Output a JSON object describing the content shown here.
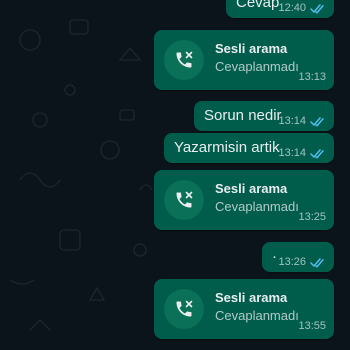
{
  "messages": [
    {
      "type": "text",
      "text": "Cevap",
      "time": "12:40",
      "status": "read"
    },
    {
      "type": "call",
      "title": "Sesli arama",
      "subtitle": "Cevaplanmadı",
      "time": "13:13",
      "icon": "missed-call-icon"
    },
    {
      "type": "text",
      "text": "Sorun nedir",
      "time": "13:14",
      "status": "read"
    },
    {
      "type": "text",
      "text": "Yazarmisin artik",
      "time": "13:14",
      "status": "read"
    },
    {
      "type": "call",
      "title": "Sesli arama",
      "subtitle": "Cevaplanmadı",
      "time": "13:25",
      "icon": "missed-call-icon"
    },
    {
      "type": "text",
      "text": "·",
      "time": "13:26",
      "status": "read"
    },
    {
      "type": "call",
      "title": "Sesli arama",
      "subtitle": "Cevaplanmadı",
      "time": "13:55",
      "icon": "missed-call-icon"
    }
  ],
  "colors": {
    "background": "#0b141a",
    "outgoing_bubble": "#005c4b",
    "text": "#e9edef",
    "read_ticks": "#53bdeb"
  }
}
